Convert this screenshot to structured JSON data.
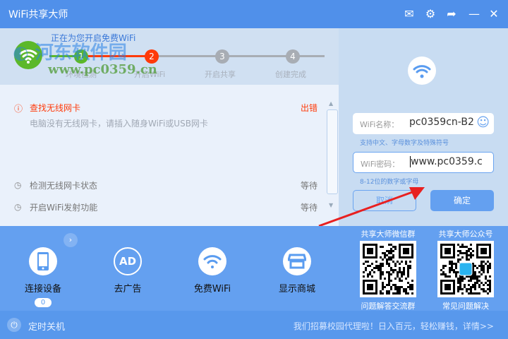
{
  "window": {
    "title": "WiFi共享大师",
    "subtitle": "正在为您开启免费WiFi"
  },
  "watermark": {
    "name": "河东软件园",
    "url": "www.pc0359.cn"
  },
  "steps": [
    {
      "num": "1",
      "label": "环境检测",
      "color": "#5cb82a"
    },
    {
      "num": "2",
      "label": "开启WiFi",
      "color": "#ff3a0a"
    },
    {
      "num": "3",
      "label": "开启共享",
      "color": "#a8adb4"
    },
    {
      "num": "4",
      "label": "创建完成",
      "color": "#a8adb4"
    }
  ],
  "tasks": [
    {
      "title": "查找无线网卡",
      "status": "出错",
      "detail": "电脑没有无线网卡，请插入随身WiFi或USB网卡"
    },
    {
      "title": "检测无线网卡状态",
      "status": "等待"
    },
    {
      "title": "开启WiFi发射功能",
      "status": "等待"
    }
  ],
  "form": {
    "name_label": "WiFi名称：",
    "name_value": "pc0359cn-B2",
    "name_hint": "支持中文、字母数字及特殊符号",
    "pwd_label": "WiFi密码：",
    "pwd_value": "www.pc0359.c",
    "pwd_hint": "8-12位的数字或字母",
    "cancel": "取消",
    "ok": "确定"
  },
  "features": [
    {
      "label": "连接设备",
      "badge": "0"
    },
    {
      "label": "去广告"
    },
    {
      "label": "免费WiFi"
    },
    {
      "label": "显示商城"
    }
  ],
  "qr": [
    {
      "title": "共享大师微信群",
      "caption": "问题解答交流群"
    },
    {
      "title": "共享大师公众号",
      "caption": "常见问题解决"
    }
  ],
  "footer": {
    "shutdown": "定时关机",
    "promo": "我们招募校园代理啦！日入百元，轻松赚钱，详情>>"
  },
  "colors": {
    "accent": "#5090ea",
    "error": "#ff3a0a"
  }
}
